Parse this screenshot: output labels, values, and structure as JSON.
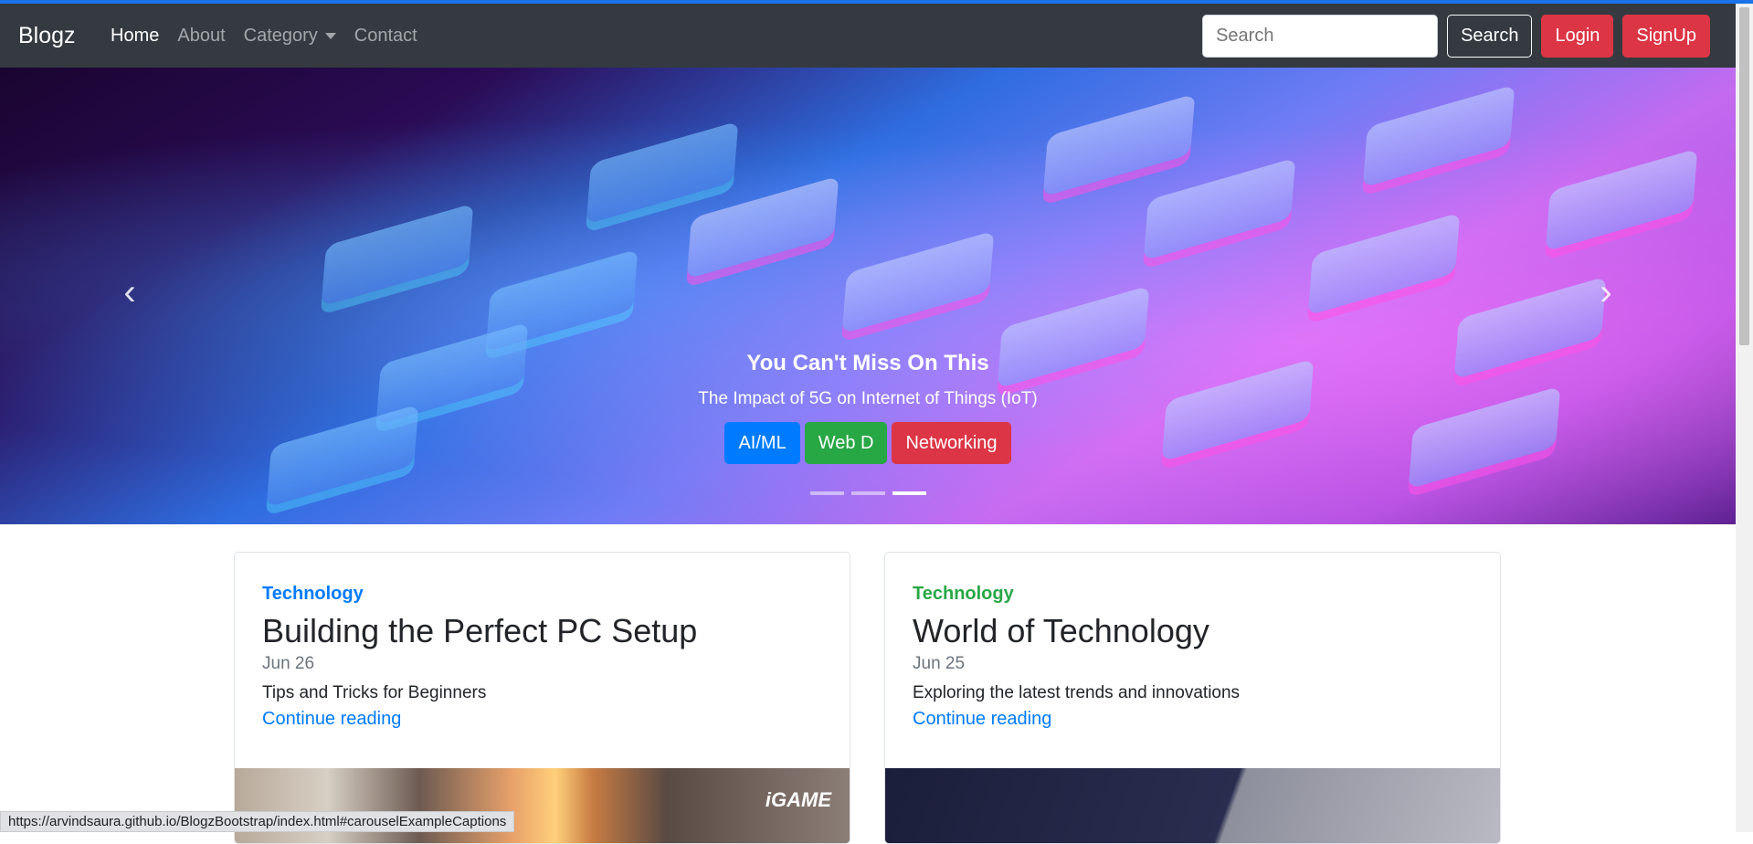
{
  "navbar": {
    "brand": "Blogz",
    "links": [
      "Home",
      "About",
      "Category",
      "Contact"
    ],
    "search_placeholder": "Search",
    "search_button": "Search",
    "login_button": "Login",
    "signup_button": "SignUp"
  },
  "carousel": {
    "heading": "You Can't Miss On This",
    "subheading": "The Impact of 5G on Internet of Things (IoT)",
    "tags": [
      "AI/ML",
      "Web D",
      "Networking"
    ],
    "prev_icon": "chevron-left-icon",
    "next_icon": "chevron-right-icon",
    "slide_count": 3,
    "active_slide": 3
  },
  "cards": [
    {
      "category": "Technology",
      "category_color": "#007bff",
      "title": "Building the Perfect PC Setup",
      "date": "Jun 26",
      "description": "Tips and Tricks for Beginners",
      "link": "Continue reading",
      "image_text": "iGAME"
    },
    {
      "category": "Technology",
      "category_color": "#28a745",
      "title": "World of Technology",
      "date": "Jun 25",
      "description": "Exploring the latest trends and innovations",
      "link": "Continue reading"
    }
  ],
  "status_bar": "https://arvindsaura.github.io/BlogzBootstrap/index.html#carouselExampleCaptions",
  "colors": {
    "navbar_bg": "#343a40",
    "danger": "#dc3545",
    "primary": "#007bff",
    "success": "#28a745"
  }
}
